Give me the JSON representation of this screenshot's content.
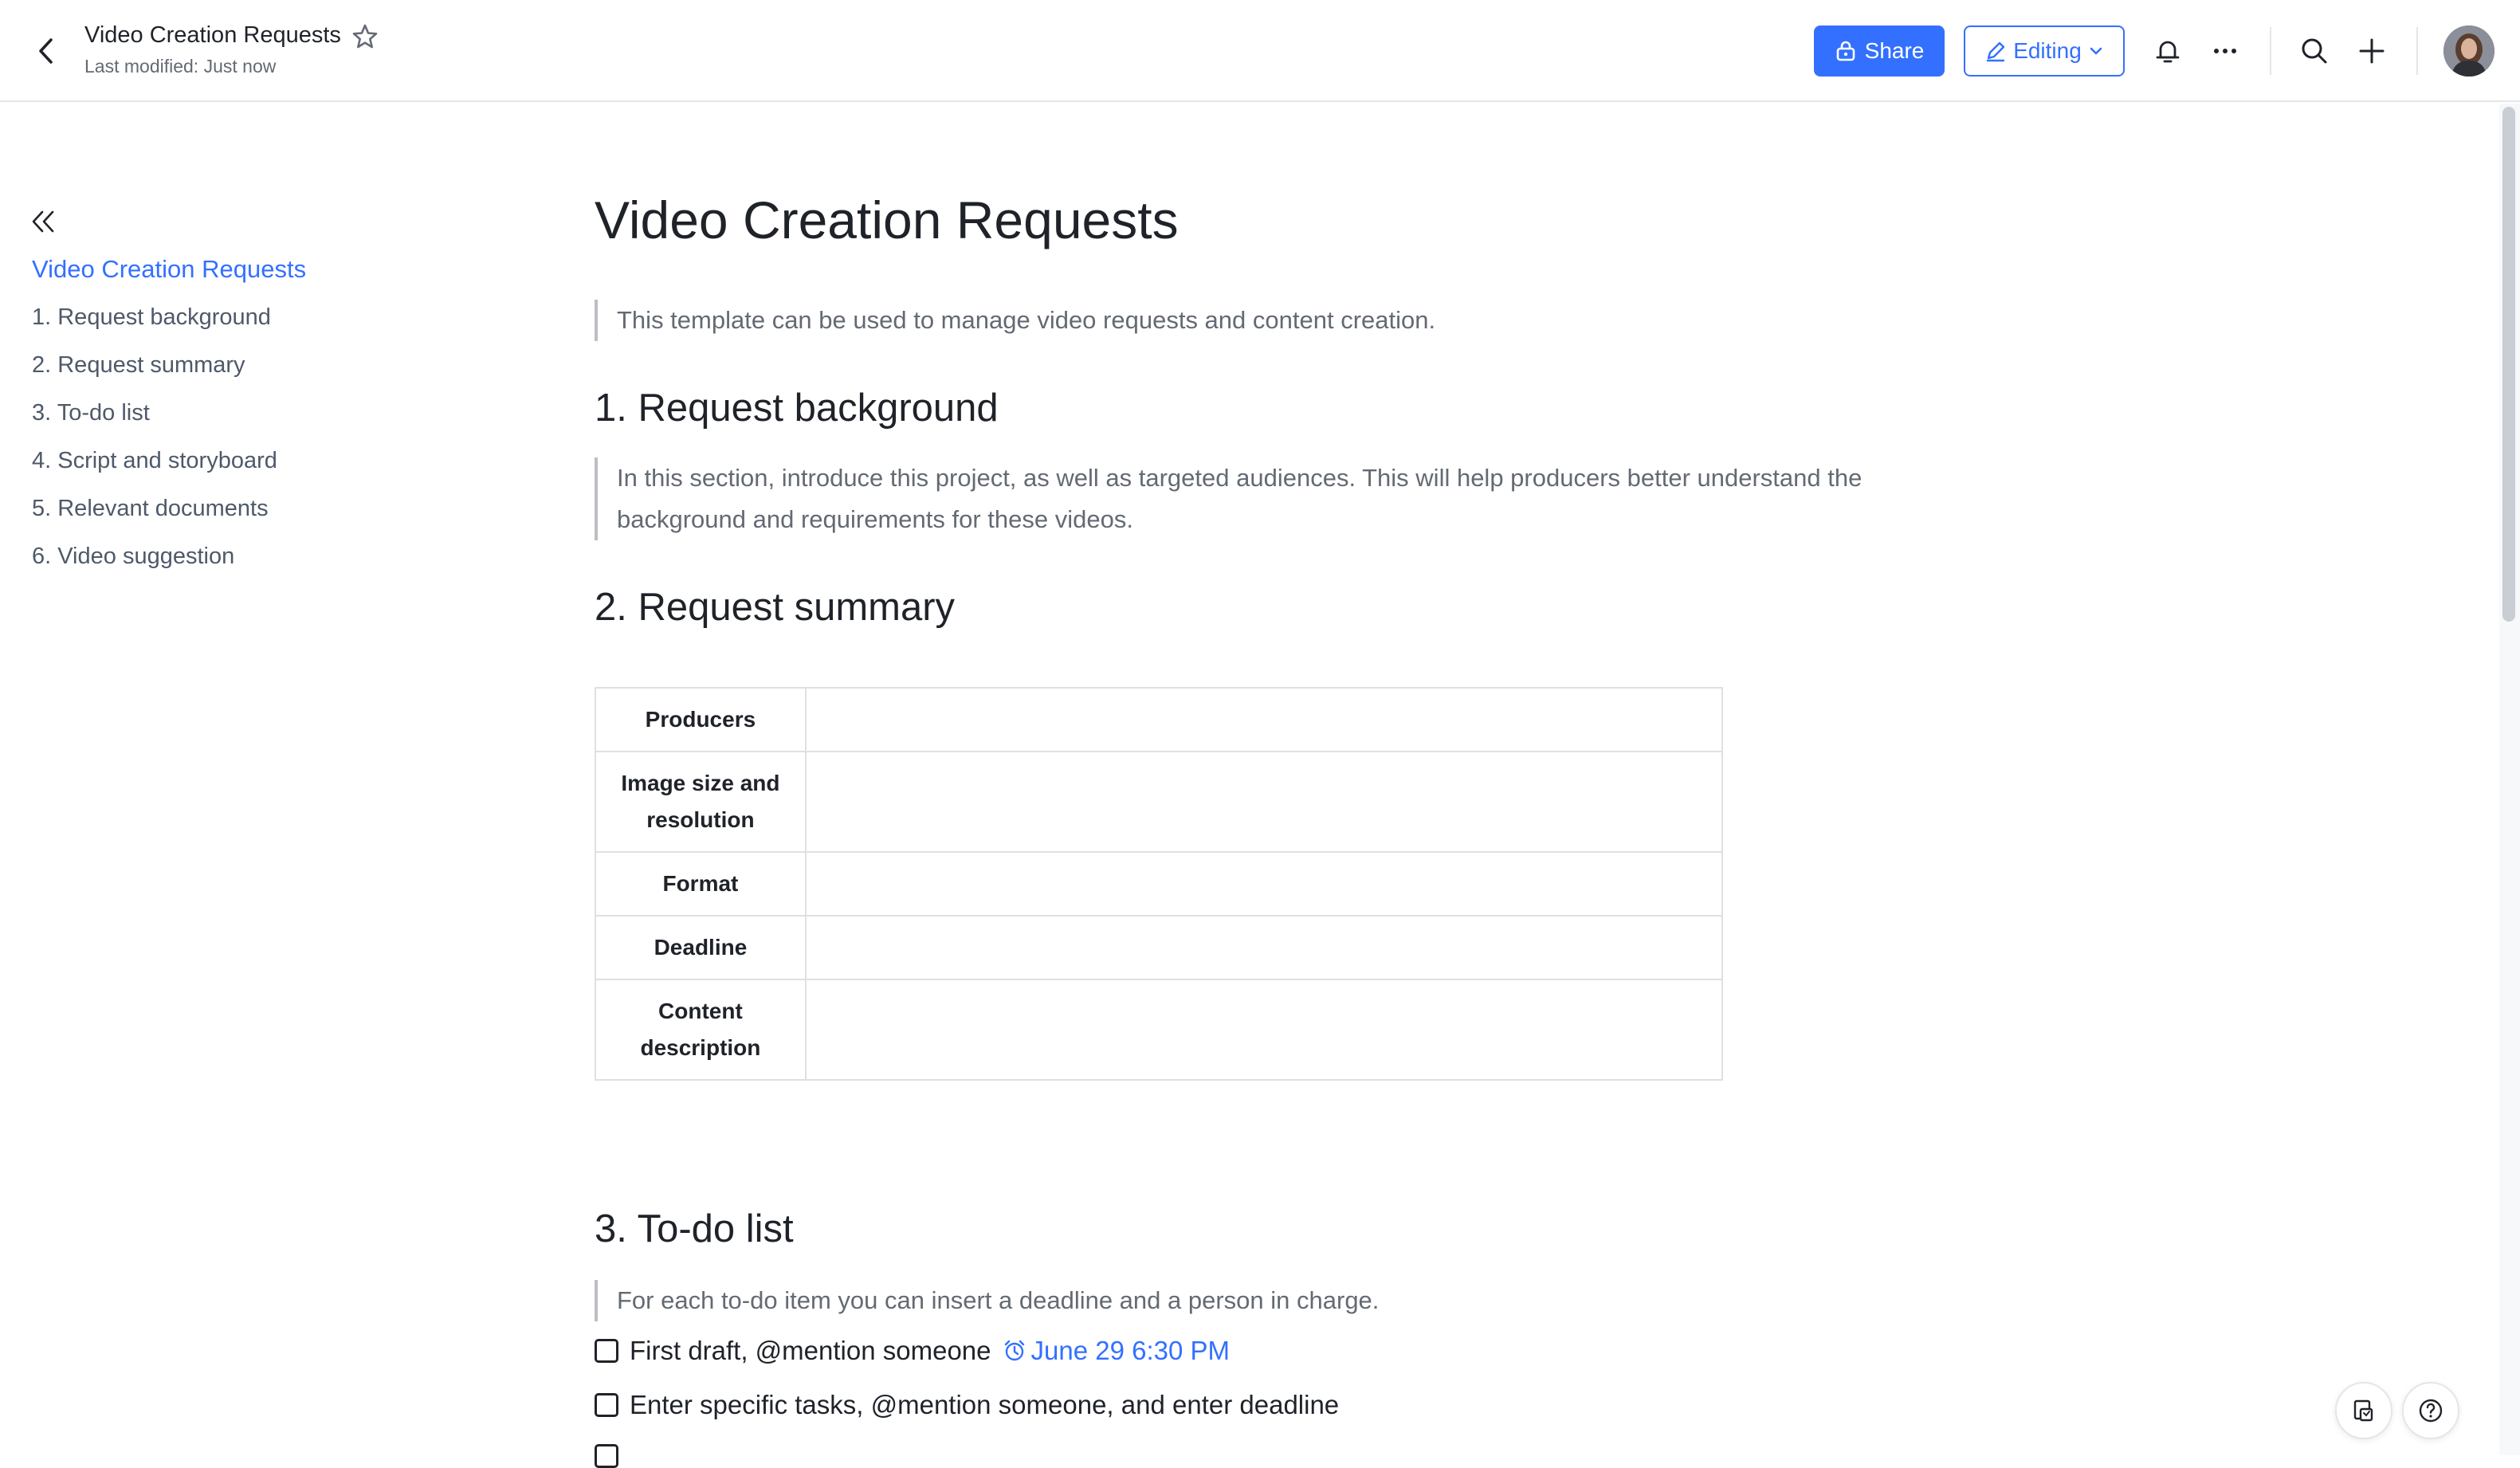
{
  "header": {
    "title": "Video Creation Requests",
    "last_modified": "Last modified: Just now",
    "share_label": "Share",
    "editing_label": "Editing"
  },
  "icons": {
    "back": "chevron-left-icon",
    "star": "star-icon",
    "share": "lock-icon",
    "editing": "pencil-icon",
    "editing_caret": "chevron-down-icon",
    "notifications": "bell-icon",
    "more": "more-horizontal-icon",
    "search": "search-icon",
    "add": "plus-icon",
    "collapse": "double-chevron-left-icon",
    "reminder": "alarm-clock-icon",
    "float_1": "document-outline-icon",
    "float_2": "help-icon"
  },
  "colors": {
    "accent": "#3370ff",
    "text_primary": "#1f2329",
    "text_secondary": "#646a73",
    "border": "#dee0e3"
  },
  "toc": {
    "items": [
      {
        "label": "Video Creation Requests",
        "active": true
      },
      {
        "label": "1. Request background"
      },
      {
        "label": "2. Request summary"
      },
      {
        "label": "3. To-do list"
      },
      {
        "label": "4. Script and storyboard"
      },
      {
        "label": "5. Relevant documents"
      },
      {
        "label": "6. Video suggestion"
      }
    ]
  },
  "doc": {
    "title": "Video Creation Requests",
    "intro": "This template can be used to manage video requests and content creation.",
    "sections": {
      "background": {
        "heading": "1.  Request background",
        "body": "In this section, introduce this project, as well as targeted audiences. This will help producers better understand the background and requirements for these videos."
      },
      "summary": {
        "heading": "2. Request summary",
        "rows": [
          {
            "label": "Producers",
            "value": ""
          },
          {
            "label": "Image size and resolution",
            "value": ""
          },
          {
            "label": "Format",
            "value": ""
          },
          {
            "label": "Deadline",
            "value": ""
          },
          {
            "label": "Content description",
            "value": ""
          }
        ]
      },
      "todo": {
        "heading": "3. To-do list",
        "note": "For each to-do item you can insert a deadline and a person in charge.",
        "items": [
          {
            "text": "First draft, @mention someone",
            "reminder": "June 29 6:30 PM",
            "checked": false
          },
          {
            "text": "Enter specific tasks, @mention someone, and enter deadline",
            "checked": false
          }
        ]
      }
    }
  }
}
